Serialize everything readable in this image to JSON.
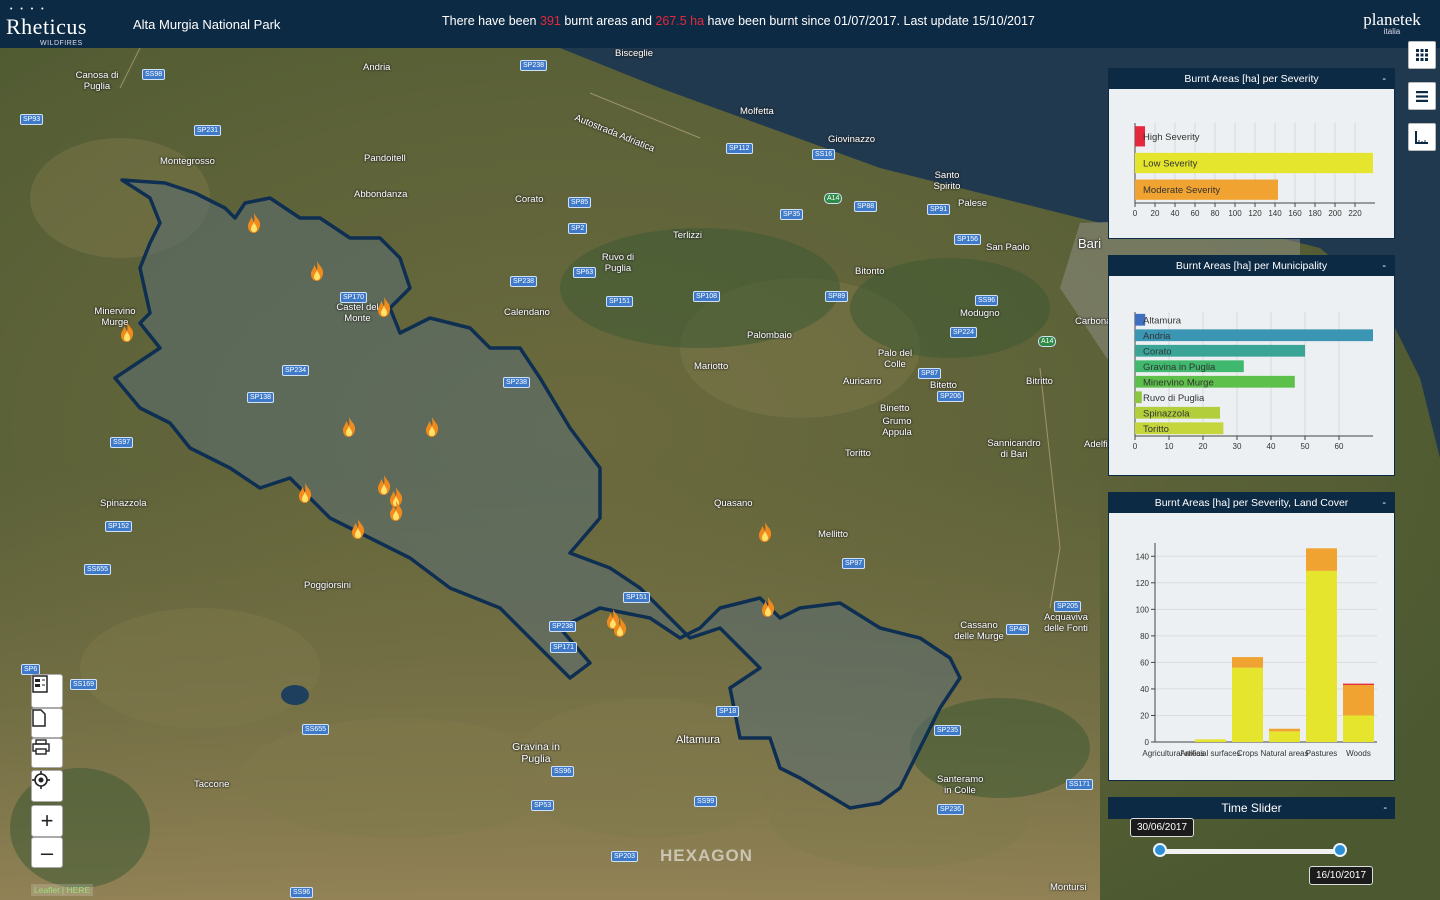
{
  "header": {
    "app_name": "Rheticus",
    "app_sub": "WILDFIRES",
    "park_title": "Alta Murgia National Park",
    "summary_prefix": "There have been ",
    "summary_count": "391",
    "summary_mid": " burnt areas and ",
    "summary_area": "267.5 ha",
    "summary_suffix": " have been burnt since 01/07/2017. Last update 15/10/2017",
    "partner_name": "planetek",
    "partner_sub": "italia"
  },
  "colors": {
    "header_bg": "#0d2a45",
    "high_severity": "#e5283b",
    "low_severity": "#e4e52c",
    "moderate_severity": "#f0a330"
  },
  "severity_chart": {
    "title": "Burnt Areas [ha] per Severity",
    "minimize": "-",
    "chart_data": {
      "type": "bar",
      "orientation": "horizontal",
      "categories": [
        "High Severity",
        "Low Severity",
        "Moderate Severity"
      ],
      "values": [
        10,
        238,
        143
      ],
      "colors": [
        "#e5283b",
        "#e4e52c",
        "#f0a330"
      ],
      "xticks": [
        "0",
        "20",
        "40",
        "60",
        "80",
        "100",
        "120",
        "140",
        "160",
        "180",
        "200",
        "220"
      ],
      "xlim": [
        0,
        240
      ]
    }
  },
  "municipality_chart": {
    "title": "Burnt Areas [ha] per Municipality",
    "minimize": "-",
    "chart_data": {
      "type": "bar",
      "orientation": "horizontal",
      "categories": [
        "Altamura",
        "Andria",
        "Corato",
        "Gravina in Puglia",
        "Minervino Murge",
        "Ruvo di Puglia",
        "Spinazzola",
        "Toritto"
      ],
      "values": [
        3,
        70,
        50,
        32,
        47,
        2,
        25,
        26
      ],
      "colors": [
        "#3e6fc0",
        "#3a96b2",
        "#3aa597",
        "#40b86e",
        "#5dc04b",
        "#8cc63e",
        "#b2cf3b",
        "#c4d63c"
      ],
      "xticks": [
        "0",
        "10",
        "20",
        "30",
        "40",
        "50",
        "60"
      ],
      "xlim": [
        0,
        70
      ]
    }
  },
  "landcover_chart": {
    "title": "Burnt Areas [ha] per Severity, Land Cover",
    "minimize": "-",
    "chart_data": {
      "type": "bar",
      "stacked": true,
      "categories": [
        "Agricultural areas",
        "Artificial surfaces",
        "Crops",
        "Natural areas",
        "Pastures",
        "Woods"
      ],
      "series": [
        {
          "name": "Low Severity",
          "values": [
            0,
            2,
            56,
            8,
            129,
            20
          ],
          "color": "#e4e52c"
        },
        {
          "name": "Moderate Severity",
          "values": [
            0,
            0,
            8,
            2,
            17,
            23
          ],
          "color": "#f0a330"
        },
        {
          "name": "High Severity",
          "values": [
            0,
            0,
            0,
            0,
            0,
            1
          ],
          "color": "#e5283b"
        }
      ],
      "yticks": [
        "0",
        "20",
        "40",
        "60",
        "80",
        "100",
        "120",
        "140"
      ],
      "ylim": [
        0,
        150
      ]
    }
  },
  "time_slider": {
    "title": "Time Slider",
    "minimize": "-",
    "start_date": "30/06/2017",
    "end_date": "16/10/2017"
  },
  "map": {
    "attribution_a": "Leaflet",
    "attribution_sep": " | ",
    "attribution_b": "HERE",
    "watermark": "HEXAGON",
    "places": [
      {
        "name": "Andria"
      },
      {
        "name": "Bisceglie"
      },
      {
        "name": "Canosa di Puglia"
      },
      {
        "name": "Molfetta"
      },
      {
        "name": "Giovinazzo"
      },
      {
        "name": "Corato"
      },
      {
        "name": "Montegrosso"
      },
      {
        "name": "Pandoitell"
      },
      {
        "name": "Abbondanza"
      },
      {
        "name": "Bari"
      },
      {
        "name": "Terlizzi"
      },
      {
        "name": "Ruvo di Puglia"
      },
      {
        "name": "Bitonto"
      },
      {
        "name": "Calendano"
      },
      {
        "name": "Palombaio"
      },
      {
        "name": "Modugno"
      },
      {
        "name": "Minervino Murge"
      },
      {
        "name": "Castel del Monte"
      },
      {
        "name": "Mariotto"
      },
      {
        "name": "Palo del Colle"
      },
      {
        "name": "Auricarro"
      },
      {
        "name": "Bitetto"
      },
      {
        "name": "Bitritto"
      },
      {
        "name": "Binetto"
      },
      {
        "name": "Grumo Appula"
      },
      {
        "name": "Toritto"
      },
      {
        "name": "Sannicandro di Bari"
      },
      {
        "name": "Spinazzola"
      },
      {
        "name": "Quasano"
      },
      {
        "name": "Mellitto"
      },
      {
        "name": "Poggiorsini"
      },
      {
        "name": "Cassano delle Murge"
      },
      {
        "name": "Acquaviva delle Fonti"
      },
      {
        "name": "Altamura"
      },
      {
        "name": "Gravina in Puglia"
      },
      {
        "name": "Santeramo in Colle"
      },
      {
        "name": "Taccone"
      },
      {
        "name": "Montursi"
      },
      {
        "name": "Santo Spirito"
      },
      {
        "name": "Palese"
      },
      {
        "name": "San Paolo"
      },
      {
        "name": "Carbonara"
      },
      {
        "name": "Adelfia"
      },
      {
        "name": "Autostrada Adriatica"
      }
    ]
  }
}
